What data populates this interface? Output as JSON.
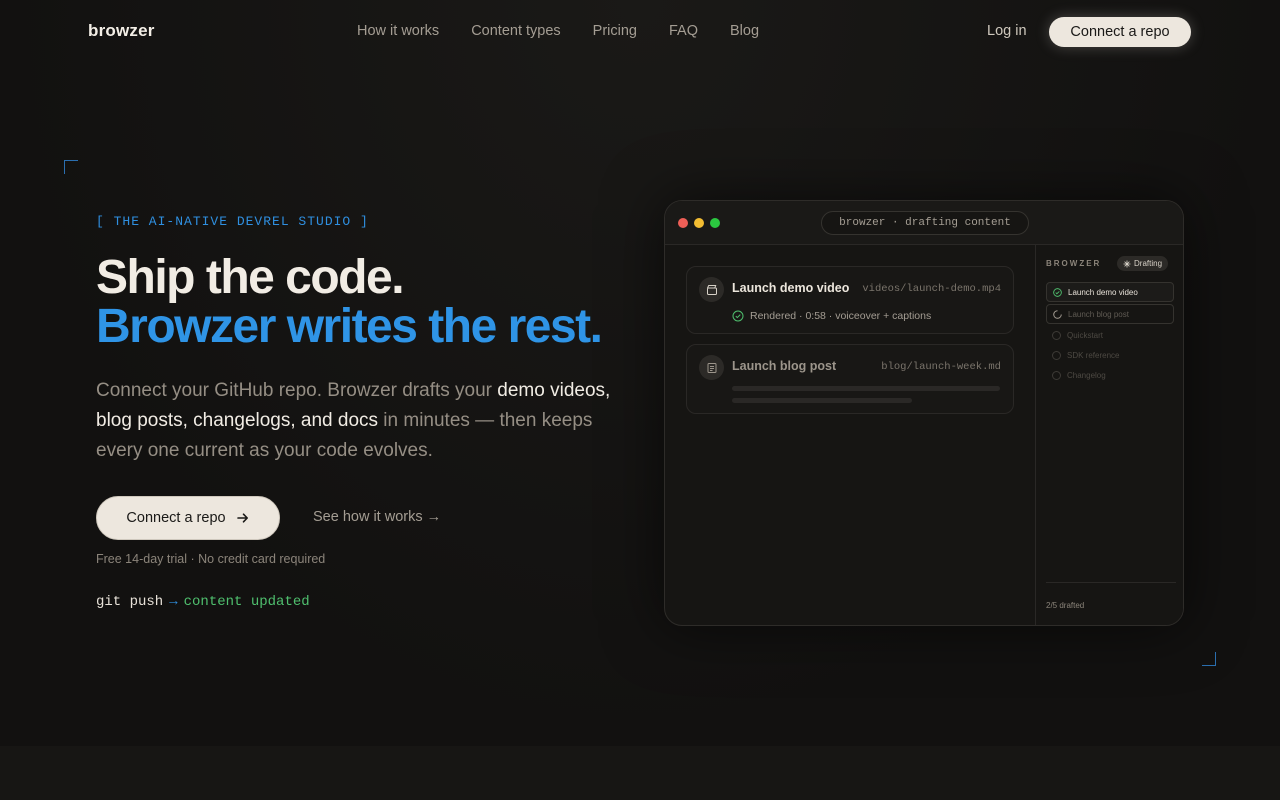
{
  "nav": {
    "brand": "browzer",
    "links": [
      "How it works",
      "Content types",
      "Pricing",
      "FAQ",
      "Blog"
    ],
    "login": "Log in",
    "cta": "Connect a repo"
  },
  "hero": {
    "eyebrow": "[ THE AI-NATIVE DEVREL STUDIO ]",
    "headline_line1": "Ship the code.",
    "headline_line2": "Browzer writes the rest.",
    "sub_before": "Connect your GitHub repo. Browzer drafts your ",
    "sub_bold": "demo videos, blog posts, changelogs, and docs",
    "sub_after": " in minutes — then keeps every one current as your code evolves.",
    "cta_primary": "Connect a repo",
    "cta_secondary": "See how it works →",
    "trial_note": "Free 14-day trial · No credit card required",
    "git_cmd": "git push",
    "git_arrow": "→",
    "git_result": "content updated"
  },
  "window": {
    "title": "browzer · drafting content",
    "cards": [
      {
        "title": "Launch demo video",
        "path": "videos/launch-demo.mp4",
        "status": "Rendered · 0:58 · voiceover + captions",
        "icon": "clapperboard-icon"
      },
      {
        "title": "Launch blog post",
        "path": "blog/launch-week.md",
        "icon": "document-icon"
      }
    ],
    "sidebar": {
      "heading": "BROWZER",
      "badge": "Drafting",
      "items": [
        {
          "label": "Launch demo video",
          "state": "done"
        },
        {
          "label": "Launch blog post",
          "state": "in-progress"
        },
        {
          "label": "Quickstart",
          "state": "pending"
        },
        {
          "label": "SDK reference",
          "state": "pending"
        },
        {
          "label": "Changelog",
          "state": "pending"
        }
      ],
      "footer": "2/5 drafted"
    }
  },
  "colors": {
    "accent_blue": "#2f94e6",
    "success_green": "#4fbf6e",
    "cta_bg": "#ede7de",
    "background": "#121110"
  }
}
